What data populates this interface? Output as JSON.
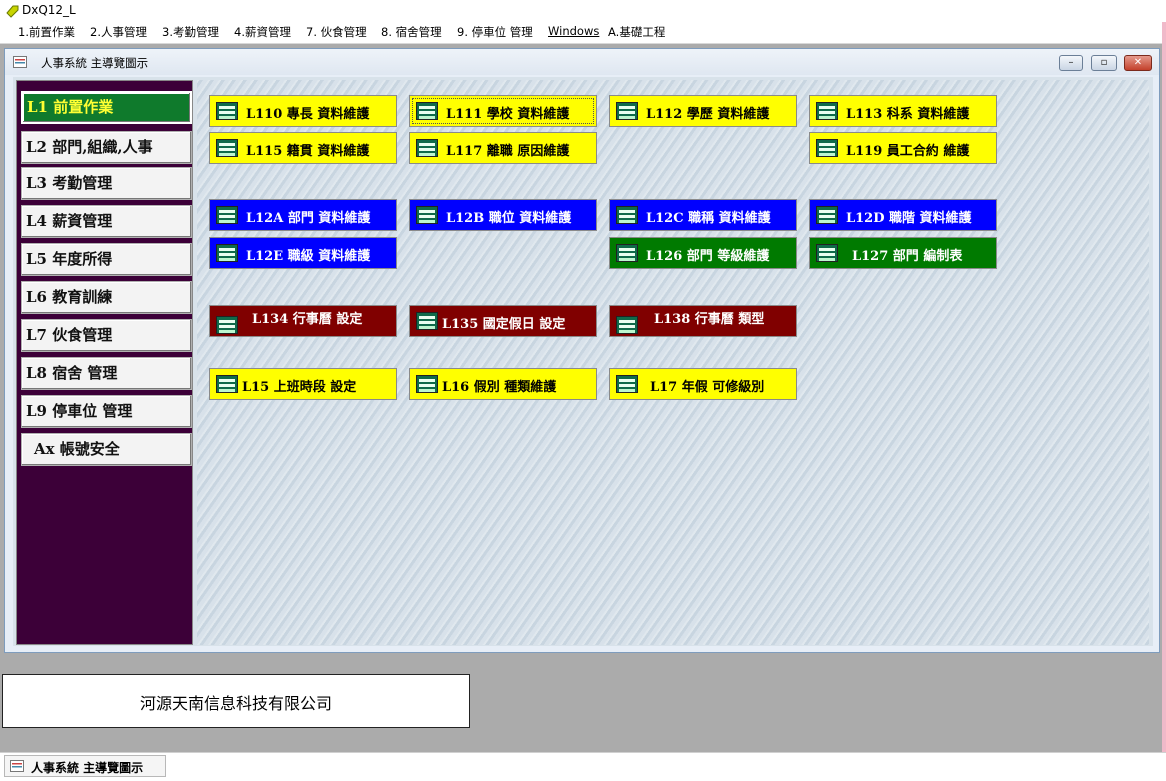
{
  "app": {
    "title": "DxQ12_L"
  },
  "menu": {
    "items": [
      "1.前置作業",
      "2.人事管理",
      "3.考勤管理",
      "4.薪資管理",
      "7. 伙食管理",
      "8. 宿舍管理",
      "9. 停車位 管理",
      "Windows",
      "A.基礎工程"
    ]
  },
  "child_window": {
    "title": "人事系統  主導覽圖示",
    "controls": {
      "minimize": "–",
      "restore": "▫",
      "close": "✕"
    }
  },
  "nav": {
    "active_index": 0,
    "items": [
      "L1  前置作業",
      "L2  部門,組織,人事",
      "L3  考勤管理",
      "L4  薪資管理",
      "L5  年度所得",
      "L6  教育訓練",
      "L7  伙食管理",
      "L8  宿舍  管理",
      "L9  停車位  管理",
      "Ax  帳號安全"
    ]
  },
  "tiles": [
    {
      "label": "L110  專長  資料維護",
      "color": "yellow"
    },
    {
      "label": "L111  學校  資料維護",
      "color": "yellow"
    },
    {
      "label": "L112  學歷  資料維護",
      "color": "yellow"
    },
    {
      "label": "L113  科系  資料維護",
      "color": "yellow"
    },
    {
      "label": "L115  籍貫  資料維護",
      "color": "yellow"
    },
    {
      "label": "L117  離職  原因維護",
      "color": "yellow"
    },
    {
      "label": "L119  員工合約  維護",
      "color": "yellow"
    },
    {
      "label": "L12A  部門  資料維護",
      "color": "blue"
    },
    {
      "label": "L12B  職位  資料維護",
      "color": "blue"
    },
    {
      "label": "L12C  職稱  資料維護",
      "color": "blue"
    },
    {
      "label": "L12D  職階  資料維護",
      "color": "blue"
    },
    {
      "label": "L12E  職級  資料維護",
      "color": "blue"
    },
    {
      "label": "L126  部門  等級維護",
      "color": "green"
    },
    {
      "label": "L127  部門  編制表",
      "color": "green"
    },
    {
      "label": "L134  行事曆  設定",
      "color": "maroon"
    },
    {
      "label": "L135  國定假日  設定",
      "color": "maroon"
    },
    {
      "label": "L138  行事曆  類型",
      "color": "maroon"
    },
    {
      "label": "L15  上班時段  設定",
      "color": "yellow"
    },
    {
      "label": "L16  假別  種類維護",
      "color": "yellow"
    },
    {
      "label": "L17  年假  可修級別",
      "color": "yellow"
    }
  ],
  "company": {
    "name": "河源天南信息科技有限公司"
  },
  "taskbar": {
    "tab_label": "人事系統  主導覽圖示"
  },
  "colors": {
    "active_nav": "#0f7a2c",
    "nav_panel": "#3c0038"
  }
}
